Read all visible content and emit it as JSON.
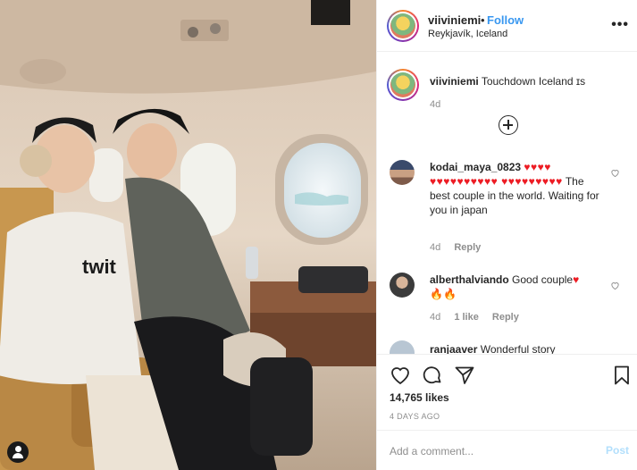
{
  "post": {
    "username": "viiviniemi",
    "follow_label": "Follow",
    "dot": "•",
    "location": "Reykjavík, Iceland",
    "more_icon": "more-horizontal-icon",
    "more_label": "•••"
  },
  "caption": {
    "username": "viiviniemi",
    "text": "Touchdown Iceland ɪs",
    "time": "4d"
  },
  "comments": [
    {
      "username": "kodai_maya_0823",
      "hearts": "♥♥♥♥ ♥♥♥♥♥♥♥♥♥♥ ♥♥♥♥♥♥♥♥♥",
      "text": "The best couple in the world. Waiting for you in japan",
      "time": "4d",
      "reply_label": "Reply"
    },
    {
      "username": "alberthalviando",
      "text": "Good couple",
      "hearts": "♥",
      "extra": "🔥🔥",
      "time": "4d",
      "likes": "1 like",
      "reply_label": "Reply"
    },
    {
      "username": "ranjaaver",
      "text": "Wonderful story"
    }
  ],
  "actions": {
    "like_icon": "heart-icon",
    "comment_icon": "comment-icon",
    "share_icon": "share-icon",
    "save_icon": "bookmark-icon",
    "likes": "14,765 likes",
    "date": "4 DAYS AGO"
  },
  "composer": {
    "placeholder": "Add a comment...",
    "post_label": "Post"
  },
  "colors": {
    "link_blue": "#3897f0",
    "heart_red": "#ed1c24",
    "post_disabled": "#b2dffc"
  }
}
